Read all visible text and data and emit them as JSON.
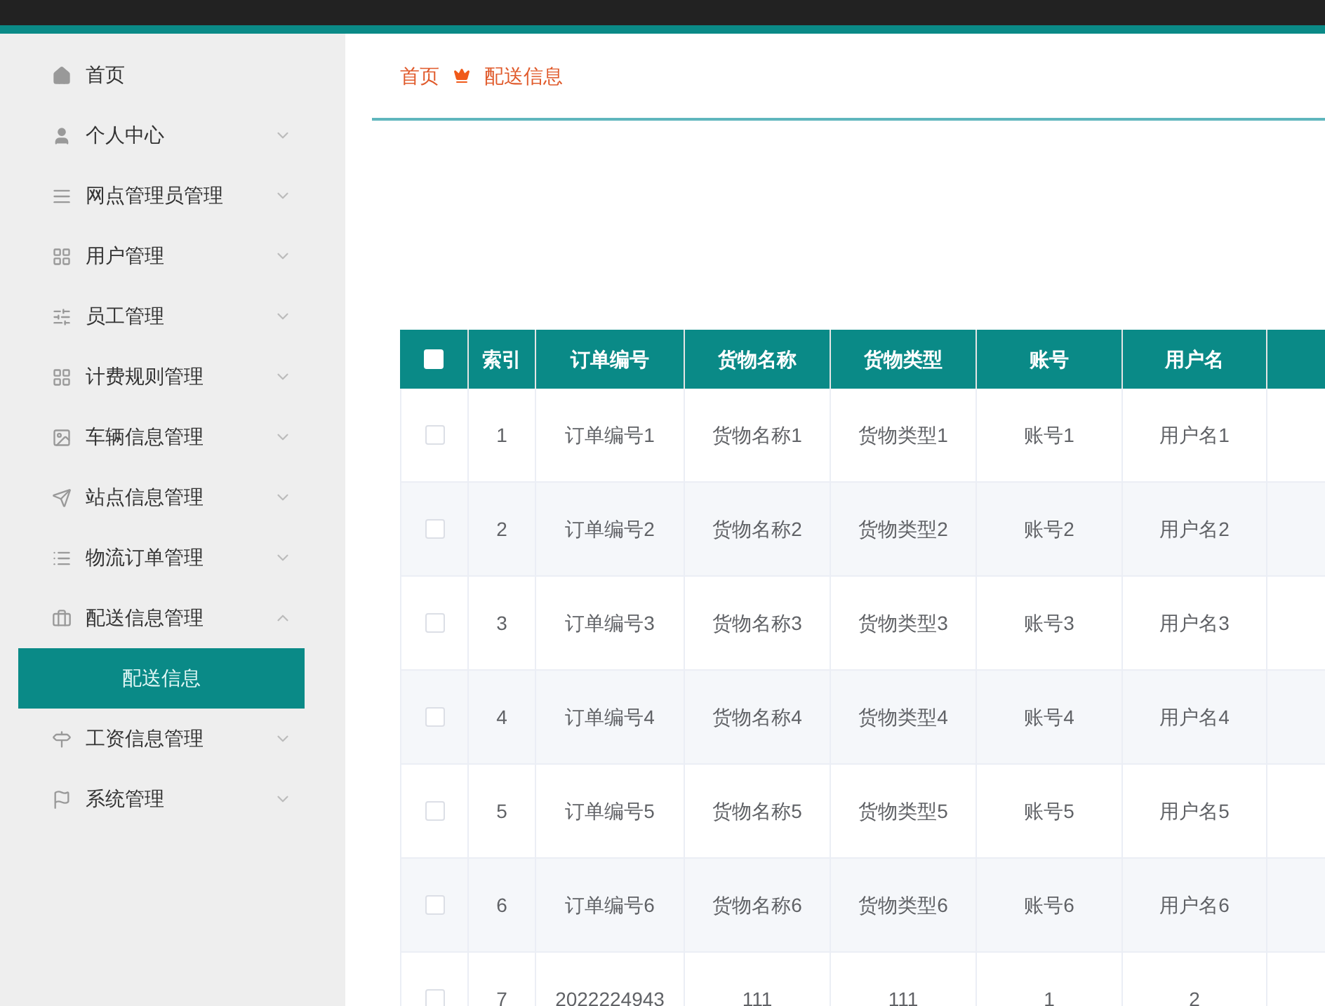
{
  "sidebar": {
    "items": [
      {
        "label": "首页"
      },
      {
        "label": "个人中心",
        "expanded": false
      },
      {
        "label": "网点管理员管理",
        "expanded": false
      },
      {
        "label": "用户管理",
        "expanded": false
      },
      {
        "label": "员工管理",
        "expanded": false
      },
      {
        "label": "计费规则管理",
        "expanded": false
      },
      {
        "label": "车辆信息管理",
        "expanded": false
      },
      {
        "label": "站点信息管理",
        "expanded": false
      },
      {
        "label": "物流订单管理",
        "expanded": false
      },
      {
        "label": "配送信息管理",
        "expanded": true,
        "children": [
          {
            "label": "配送信息",
            "selected": true
          }
        ]
      },
      {
        "label": "工资信息管理",
        "expanded": false
      },
      {
        "label": "系统管理",
        "expanded": false
      }
    ]
  },
  "breadcrumb": [
    "首页",
    "配送信息"
  ],
  "table": {
    "select_all": {
      "checked": false
    },
    "columns": [
      "索引",
      "订单编号",
      "货物名称",
      "货物类型",
      "账号",
      "用户名"
    ],
    "rows": [
      {
        "checked": false,
        "cells": [
          "1",
          "订单编号1",
          "货物名称1",
          "货物类型1",
          "账号1",
          "用户名1"
        ]
      },
      {
        "checked": false,
        "cells": [
          "2",
          "订单编号2",
          "货物名称2",
          "货物类型2",
          "账号2",
          "用户名2"
        ]
      },
      {
        "checked": false,
        "cells": [
          "3",
          "订单编号3",
          "货物名称3",
          "货物类型3",
          "账号3",
          "用户名3"
        ]
      },
      {
        "checked": false,
        "cells": [
          "4",
          "订单编号4",
          "货物名称4",
          "货物类型4",
          "账号4",
          "用户名4"
        ]
      },
      {
        "checked": false,
        "cells": [
          "5",
          "订单编号5",
          "货物名称5",
          "货物类型5",
          "账号5",
          "用户名5"
        ]
      },
      {
        "checked": false,
        "cells": [
          "6",
          "订单编号6",
          "货物名称6",
          "货物类型6",
          "账号6",
          "用户名6"
        ]
      },
      {
        "checked": false,
        "cells": [
          "7",
          "2022224943",
          "111",
          "111",
          "1",
          "2"
        ]
      }
    ]
  }
}
